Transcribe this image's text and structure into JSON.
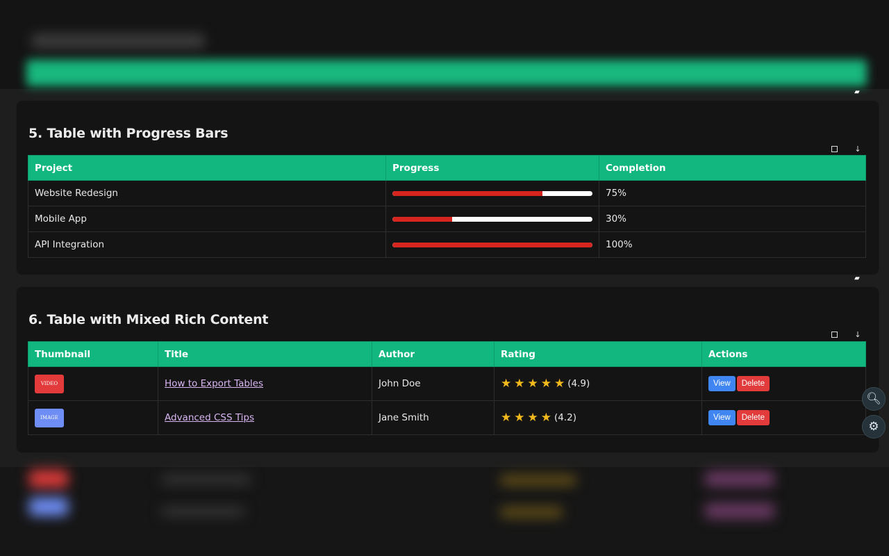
{
  "section5": {
    "title": "5. Table with Progress Bars",
    "headers": [
      "Project",
      "Progress",
      "Completion"
    ],
    "rows": [
      {
        "project": "Website Redesign",
        "progress": 0.75,
        "completion": "75%"
      },
      {
        "project": "Mobile App",
        "progress": 0.3,
        "completion": "30%"
      },
      {
        "project": "API Integration",
        "progress": 1.0,
        "completion": "100%"
      }
    ]
  },
  "section6": {
    "title": "6. Table with Mixed Rich Content",
    "headers": [
      "Thumbnail",
      "Title",
      "Author",
      "Rating",
      "Actions"
    ],
    "rows": [
      {
        "thumb_label": "VIDEO",
        "thumb_color": "#e33b3b",
        "title": "How to Export Tables",
        "author": "John Doe",
        "stars": 5,
        "rating_text": "(4.9)",
        "view": "View",
        "delete": "Delete"
      },
      {
        "thumb_label": "IMAGE",
        "thumb_color": "#6f8ef5",
        "title": "Advanced CSS Tips",
        "author": "Jane Smith",
        "stars": 4,
        "rating_text": "(4.2)",
        "view": "View",
        "delete": "Delete"
      }
    ]
  },
  "toolbar_icons": [
    "square-icon",
    "download-icon",
    "clipboard-icon"
  ],
  "floating_buttons": [
    "search-icon",
    "gear-icon"
  ],
  "colors": {
    "accent": "#12b77f",
    "progress": "#d6241f",
    "view": "#3f86f2",
    "delete": "#e23b3b",
    "star": "#f2b91c",
    "link": "#d9b6f2"
  }
}
